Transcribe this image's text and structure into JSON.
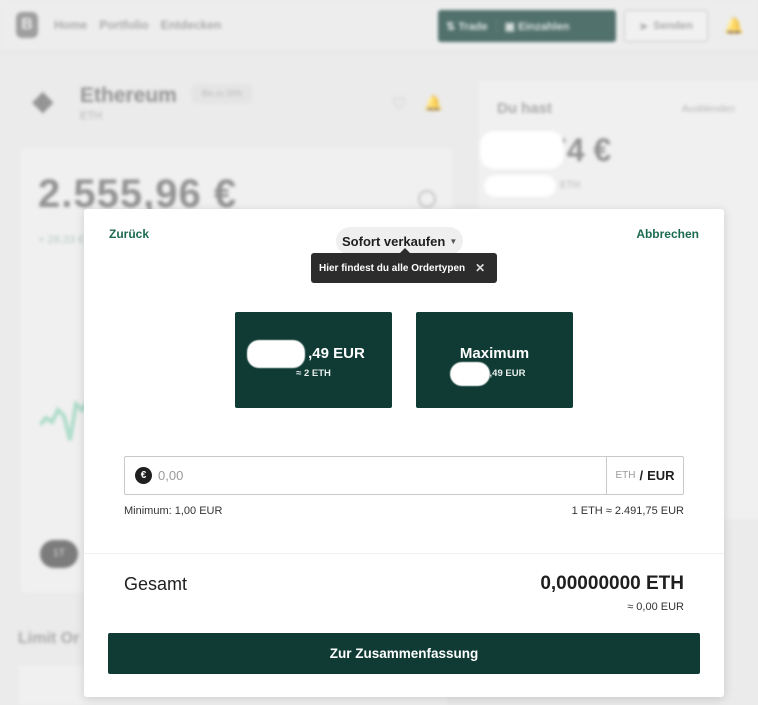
{
  "background": {
    "nav": [
      "Home",
      "Portfolio",
      "Entdecken"
    ],
    "trade_label": "Trade",
    "deposit_label": "Einzahlen",
    "send_label": "Senden",
    "asset_name": "Ethereum",
    "asset_ticker": "ETH",
    "asset_badge": "Bis zu 15%",
    "price": "2.555,96 €",
    "price_change": "+ 28,33 €",
    "timeframe": "1T",
    "limit_orders": "Limit Or",
    "holdings_title": "Du hast",
    "holdings_toggle": "Ausblenden",
    "holdings_value": ",74 €",
    "holdings_sub": "ETH",
    "accent_color": "#0f3b34"
  },
  "modal": {
    "back_label": "Zurück",
    "cancel_label": "Abbrechen",
    "order_type": "Sofort verkaufen",
    "tooltip": "Hier findest du alle Ordertypen",
    "preset_a_value": ",49 EUR",
    "preset_a_sub": "≈ 2 ETH",
    "preset_b_label": "Maximum",
    "preset_b_sub": ",49 EUR",
    "amount_placeholder": "0,00",
    "unit_eth": "ETH",
    "unit_sep": "/",
    "unit_eur": "EUR",
    "currency_symbol": "€",
    "minimum": "Minimum: 1,00 EUR",
    "rate": "1 ETH ≈ 2.491,75 EUR",
    "total_label": "Gesamt",
    "total_eth": "0,00000000 ETH",
    "total_eur": "≈ 0,00 EUR",
    "cta_label": "Zur Zusammenfassung"
  }
}
